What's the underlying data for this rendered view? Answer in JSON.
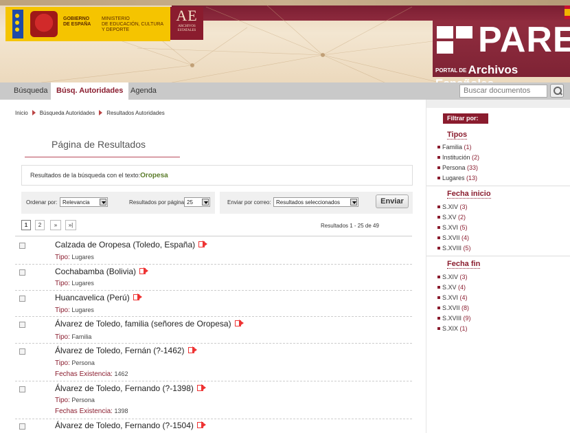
{
  "header": {
    "gob_line1": "GOBIERNO",
    "gob_line2": "DE ESPAÑA",
    "min_line1": "MINISTERIO",
    "min_line2": "DE EDUCACIÓN, CULTURA",
    "min_line3": "Y DEPORTE",
    "ae_big": "AE",
    "ae_small1": "ARCHIVOS",
    "ae_small2": "ESTATALES",
    "pares_word": "PARES",
    "portal_prefix": "PORTAL DE",
    "portal_main": "Archivos Españoles"
  },
  "nav": {
    "tabs": [
      {
        "label": "Búsqueda"
      },
      {
        "label": "Búsq. Autoridades"
      },
      {
        "label": "Agenda"
      }
    ],
    "search_placeholder": "Buscar documentos"
  },
  "breadcrumb": [
    "Inicio",
    "Búsqueda Autoridades",
    "Resultados Autoridades"
  ],
  "page_title": "Página de Resultados",
  "query": {
    "label": "Resultados de la búsqueda con el texto:",
    "value": "Oropesa"
  },
  "order": {
    "label": "Ordenar por:",
    "value": "Relevancia",
    "per_page_label": "Resultados por página:",
    "per_page_value": "25"
  },
  "send": {
    "label": "Enviar por correo:",
    "value": "Resultados seleccionados",
    "button": "Enviar"
  },
  "pager": {
    "p1": "1",
    "p2": "2",
    "next": "»",
    "last": "»|",
    "count": "Resultados 1 - 25 de 49"
  },
  "results": [
    {
      "title": "Calzada de Oropesa (Toledo, España)",
      "tipo_label": "Tipo:",
      "tipo": "Lugares"
    },
    {
      "title": "Cochabamba (Bolivia)",
      "tipo_label": "Tipo:",
      "tipo": "Lugares"
    },
    {
      "title": "Huancavelica (Perú)",
      "tipo_label": "Tipo:",
      "tipo": "Lugares"
    },
    {
      "title": "Álvarez de Toledo, familia (señores de Oropesa)",
      "tipo_label": "Tipo:",
      "tipo": "Familia"
    },
    {
      "title": "Álvarez de Toledo, Fernán (?-1462)",
      "tipo_label": "Tipo:",
      "tipo": "Persona",
      "fechas_label": "Fechas Existencia:",
      "fechas": "1462"
    },
    {
      "title": "Álvarez de Toledo, Fernando (?-1398)",
      "tipo_label": "Tipo:",
      "tipo": "Persona",
      "fechas_label": "Fechas Existencia:",
      "fechas": "1398"
    },
    {
      "title": "Álvarez de Toledo, Fernando (?-1504)"
    }
  ],
  "sidebar": {
    "filter_label": "Filtrar por:",
    "tipos": {
      "heading": "Tipos",
      "items": [
        {
          "label": "Familia",
          "count": "(1)"
        },
        {
          "label": "Institución",
          "count": "(2)"
        },
        {
          "label": "Persona",
          "count": "(33)"
        },
        {
          "label": "Lugares",
          "count": "(13)"
        }
      ]
    },
    "fecha_inicio": {
      "heading": "Fecha inicio",
      "items": [
        {
          "label": "S.XIV",
          "count": "(3)"
        },
        {
          "label": "S.XV",
          "count": "(2)"
        },
        {
          "label": "S.XVI",
          "count": "(5)"
        },
        {
          "label": "S.XVII",
          "count": "(4)"
        },
        {
          "label": "S.XVIII",
          "count": "(5)"
        }
      ]
    },
    "fecha_fin": {
      "heading": "Fecha fin",
      "items": [
        {
          "label": "S.XIV",
          "count": "(3)"
        },
        {
          "label": "S.XV",
          "count": "(4)"
        },
        {
          "label": "S.XVI",
          "count": "(4)"
        },
        {
          "label": "S.XVII",
          "count": "(8)"
        },
        {
          "label": "S.XVIII",
          "count": "(9)"
        },
        {
          "label": "S.XIX",
          "count": "(1)"
        }
      ]
    }
  },
  "colors": {
    "accent": "#8a1c2e",
    "query_value": "#5b7c2a"
  },
  "icons": [
    "external-link-icon",
    "search-icon",
    "dropdown-arrow-icon"
  ]
}
